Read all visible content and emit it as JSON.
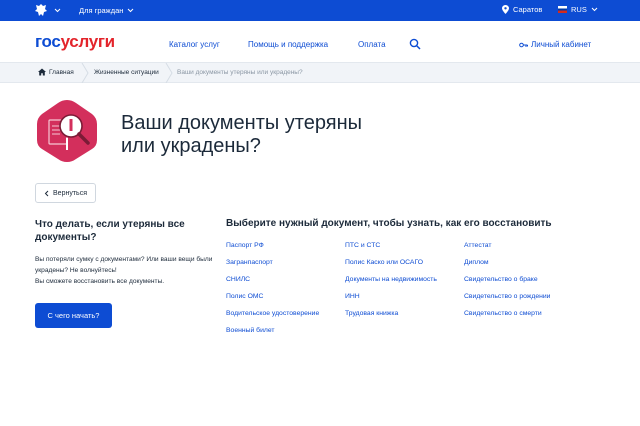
{
  "topbar": {
    "for_citizens": "Для граждан",
    "location": "Саратов",
    "language": "RUS"
  },
  "header": {
    "logo_part1": "гос",
    "logo_part2": "услуги",
    "nav": [
      "Каталог услуг",
      "Помощь и поддержка",
      "Оплата"
    ],
    "cabinet": "Личный кабинет"
  },
  "breadcrumb": {
    "home": "Главная",
    "section": "Жизненные ситуации",
    "current": "Ваши документы утеряны или украдены?"
  },
  "hero": {
    "title_line1": "Ваши документы утеряны",
    "title_line2": "или украдены?"
  },
  "back_label": "Вернуться",
  "left": {
    "title": "Что делать, если утеряны все документы?",
    "line1": "Вы потеряли сумку с документами? Или ваши вещи были украдены? Не волнуйтесь!",
    "line2": "Вы сможете восстановить все документы.",
    "start_label": "С чего начать?"
  },
  "right": {
    "title": "Выберите нужный документ, чтобы узнать, как его восстановить",
    "col1": [
      "Паспорт РФ",
      "Загранпаспорт",
      "СНИЛС",
      "Полис ОМС",
      "Водительское удостоверение",
      "Военный билет"
    ],
    "col2": [
      "ПТС и СТС",
      "Полис Каско или ОСАГО",
      "Документы на недвижимость",
      "ИНН",
      "Трудовая книжка"
    ],
    "col3": [
      "Аттестат",
      "Диплом",
      "Свидетельство о браке",
      "Свидетельство о рождении",
      "Свидетельство о смерти"
    ]
  },
  "colors": {
    "brand_blue": "#0d4cd3",
    "brand_red": "#e3242b",
    "hero_icon": "#d32f5c"
  }
}
